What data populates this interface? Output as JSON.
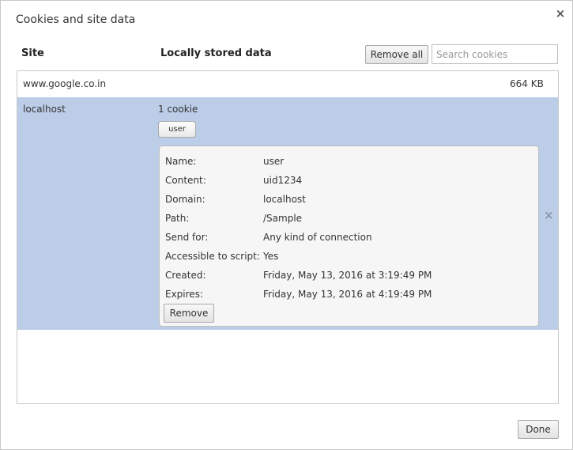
{
  "dialog": {
    "title": "Cookies and site data",
    "close_glyph": "×"
  },
  "header": {
    "site_label": "Site",
    "data_label": "Locally stored data",
    "remove_all_label": "Remove all",
    "search_placeholder": "Search cookies"
  },
  "sites": [
    {
      "site": "www.google.co.in",
      "size": "664 KB"
    },
    {
      "site": "localhost",
      "summary": "1 cookie",
      "cookie_chip": "user",
      "remove_glyph": "×"
    }
  ],
  "cookie_details": {
    "rows": [
      {
        "key": "Name:",
        "value": "user"
      },
      {
        "key": "Content:",
        "value": "uid1234"
      },
      {
        "key": "Domain:",
        "value": "localhost"
      },
      {
        "key": "Path:",
        "value": "/Sample"
      },
      {
        "key": "Send for:",
        "value": "Any kind of connection"
      },
      {
        "key": "Accessible to script:",
        "value": "Yes"
      },
      {
        "key": "Created:",
        "value": "Friday, May 13, 2016 at 3:19:49 PM"
      },
      {
        "key": "Expires:",
        "value": "Friday, May 13, 2016 at 4:19:49 PM"
      }
    ],
    "remove_label": "Remove"
  },
  "footer": {
    "done_label": "Done"
  },
  "colors": {
    "selected_row": "#bccde8",
    "detail_bg": "#f6f6f6"
  }
}
